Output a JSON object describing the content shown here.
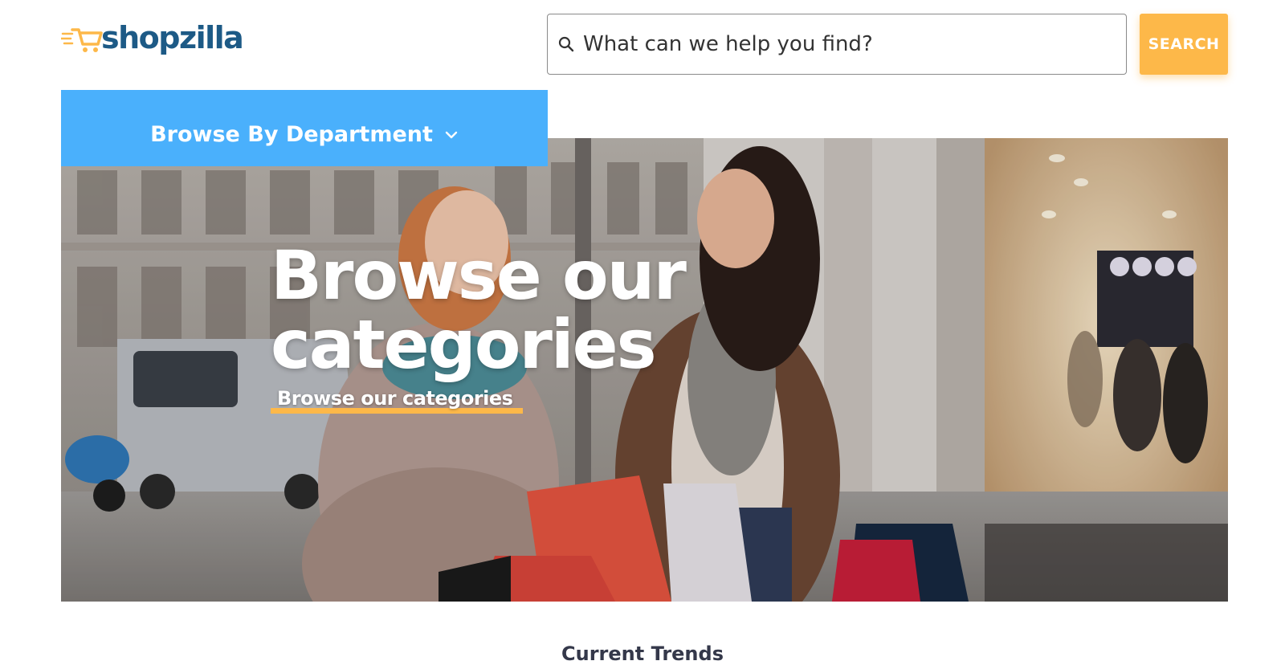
{
  "brand": {
    "name": "shopzilla",
    "logo_icon": "cart-icon",
    "text_color": "#1d5a86",
    "accent_color": "#fdb849"
  },
  "search": {
    "placeholder": "What can we help you find?",
    "button_label": "SEARCH",
    "icon": "search-icon"
  },
  "nav": {
    "browse_department_label": "Browse By Department",
    "browse_color": "#4ab0fc",
    "chevron_icon": "chevron-down-icon"
  },
  "hero": {
    "title": "Browse our categories",
    "link_label": "Browse our categories"
  },
  "sections": {
    "current_trends_title": "Current Trends"
  }
}
